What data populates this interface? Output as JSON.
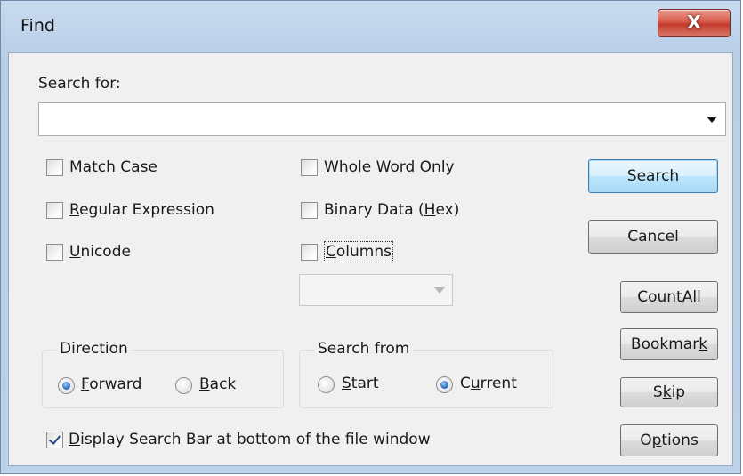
{
  "window": {
    "title": "Find",
    "close_glyph": "X"
  },
  "search": {
    "label": "Search for:",
    "value": "",
    "placeholder": ""
  },
  "options": {
    "match_case": {
      "pre": "Match ",
      "u": "C",
      "post": "ase",
      "checked": false
    },
    "regular_expression": {
      "pre": "",
      "u": "R",
      "post": "egular Expression",
      "checked": false
    },
    "unicode": {
      "pre": "",
      "u": "U",
      "post": "nicode",
      "checked": false
    },
    "whole_word_only": {
      "pre": "",
      "u": "W",
      "post": "hole Word Only",
      "checked": false
    },
    "binary_data": {
      "pre": "Binary Data (",
      "u": "H",
      "post": "ex)",
      "checked": false
    },
    "columns": {
      "pre": "",
      "u": "C",
      "post": "olumns",
      "checked": false
    },
    "display_search_bar": {
      "pre": "",
      "u": "D",
      "post": "isplay Search Bar at bottom of the file window",
      "checked": true
    }
  },
  "direction": {
    "label": "Direction",
    "forward": {
      "pre": "",
      "u": "F",
      "post": "orward",
      "selected": true
    },
    "back": {
      "pre": "",
      "u": "B",
      "post": "ack",
      "selected": false
    }
  },
  "search_from": {
    "label": "Search from",
    "start": {
      "pre": "",
      "u": "S",
      "post": "tart",
      "selected": false
    },
    "current": {
      "pre": "C",
      "u": "u",
      "post": "rrent",
      "selected": true
    }
  },
  "buttons": {
    "search": "Search",
    "cancel": "Cancel",
    "count_all": {
      "pre": "Count ",
      "u": "A",
      "post": "ll"
    },
    "bookmark": {
      "pre": "Bookmar",
      "u": "k",
      "post": ""
    },
    "skip": {
      "pre": "S",
      "u": "k",
      "post": "ip"
    },
    "options": {
      "pre": "O",
      "u": "p",
      "post": "tions"
    }
  },
  "colors": {
    "accent": "#3c7fb1",
    "close": "#c23c2c"
  }
}
